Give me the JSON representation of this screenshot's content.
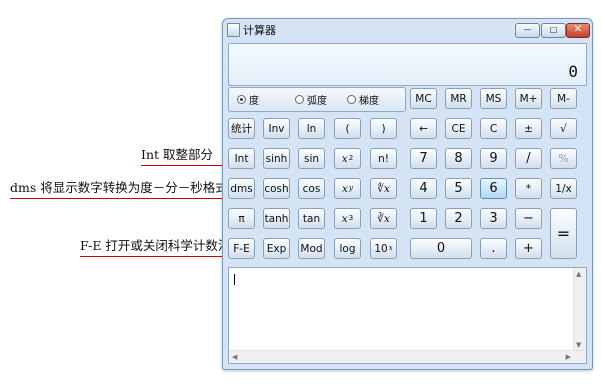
{
  "annotations": {
    "int": "Int 取整部分",
    "dms": "dms 将显示数字转换为度－分－秒格式",
    "fe": "F-E 打开或关闭科学计数法"
  },
  "window": {
    "title": "计算器",
    "minimize": "—",
    "maximize": "□",
    "close": "✕"
  },
  "display": {
    "value": "0"
  },
  "modes": {
    "degrees": "度",
    "radians": "弧度",
    "grads": "梯度",
    "selected": "degrees"
  },
  "buttons": {
    "mc": "MC",
    "mr": "MR",
    "ms": "MS",
    "mplus": "M+",
    "mminus": "M-",
    "stat": "统计",
    "inv": "Inv",
    "ln": "ln",
    "lparen": "(",
    "rparen": ")",
    "backspace": "←",
    "ce": "CE",
    "c": "C",
    "plusminus": "±",
    "sqrt": "√",
    "int": "Int",
    "sinh": "sinh",
    "sin": "sin",
    "x2_base": "x",
    "x2_exp": "2",
    "fact": "n!",
    "n7": "7",
    "n8": "8",
    "n9": "9",
    "div": "/",
    "pct": "%",
    "dms": "dms",
    "cosh": "cosh",
    "cos": "cos",
    "xy_base": "x",
    "xy_exp": "y",
    "yroot": "∜x",
    "n4": "4",
    "n5": "5",
    "n6": "6",
    "mul": "*",
    "recip": "1/x",
    "pi": "π",
    "tanh": "tanh",
    "tan": "tan",
    "x3_base": "x",
    "x3_exp": "3",
    "cbrt": "∛x",
    "n1": "1",
    "n2": "2",
    "n3": "3",
    "minus": "−",
    "eq": "=",
    "fe": "F-E",
    "exp": "Exp",
    "mod": "Mod",
    "log": "log",
    "tenx_base": "10",
    "tenx_exp": "x",
    "n0": "0",
    "dot": ".",
    "plus": "+"
  },
  "history": {
    "text": ""
  },
  "colors": {
    "accent": "#cc0000",
    "window_bg": "#d4e4f5",
    "highlight": "#c9e5f8"
  },
  "scroll": {
    "up": "▲",
    "down": "▼",
    "left": "◀",
    "right": "▶"
  }
}
